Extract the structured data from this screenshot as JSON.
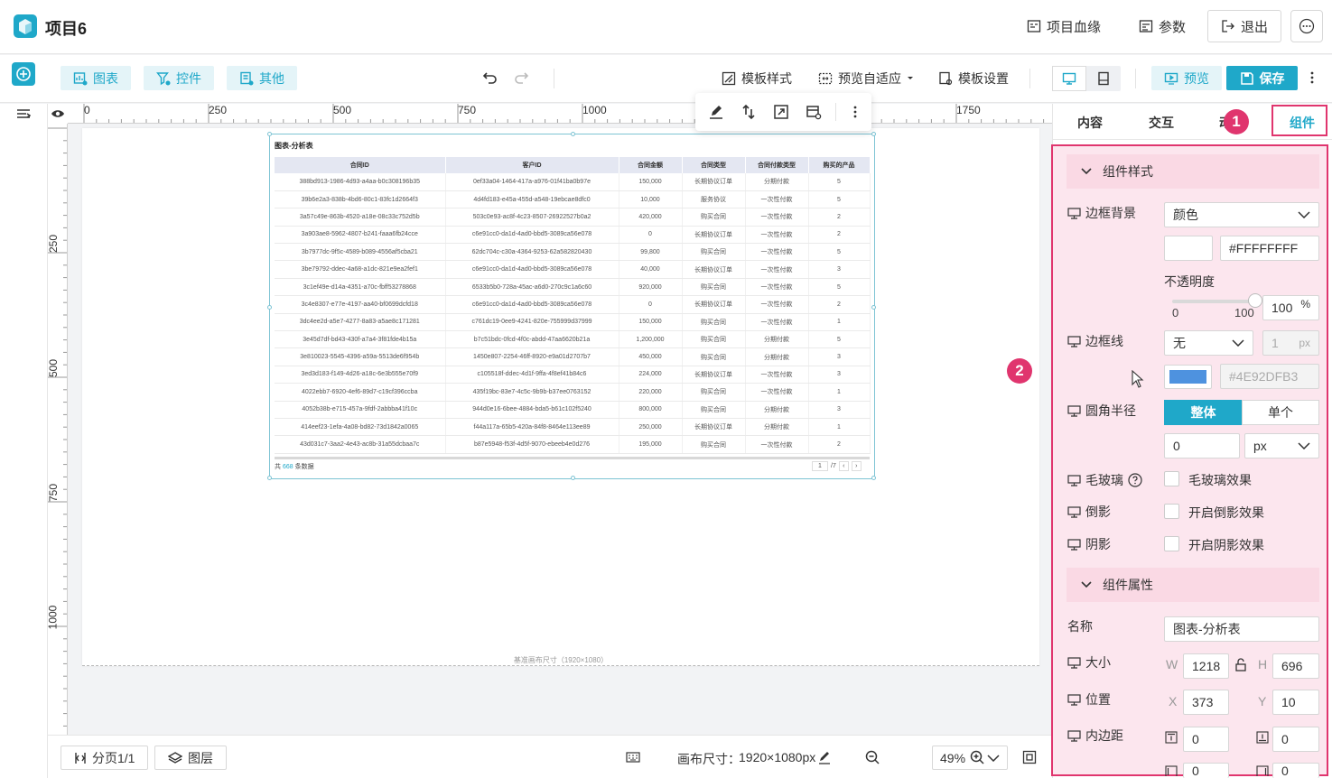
{
  "header": {
    "title": "项目6",
    "lineage": "项目血缘",
    "params": "参数",
    "exit": "退出"
  },
  "toolbar": {
    "chart": "图表",
    "control": "控件",
    "other": "其他",
    "template_style": "模板样式",
    "preview_adaptive": "预览自适应",
    "template_settings": "模板设置",
    "preview": "预览",
    "save": "保存"
  },
  "ruler": {
    "h_labels": [
      "0",
      "250",
      "500",
      "750",
      "1000",
      "1750"
    ],
    "v_labels": [
      "250",
      "500",
      "750",
      "1000"
    ]
  },
  "widget": {
    "title": "图表-分析表",
    "columns": [
      "合同ID",
      "客户ID",
      "合同金额",
      "合同类型",
      "合同付款类型",
      "购买的产品"
    ],
    "rows": [
      [
        "388bd913-1986-4d93-a4aa-b0c308196b35",
        "0ef33a04-1464-417a-a976-01f41ba0b97e",
        "150,000",
        "长期协议订单",
        "分期付款",
        "5"
      ],
      [
        "39b6e2a3-838b-4bd6-80c1-83fc1d2664f3",
        "4d4fd183-e45a-455d-a548-19ebcae8dfc0",
        "10,000",
        "服务协议",
        "一次性付款",
        "5"
      ],
      [
        "3a57c49e-863b-4520-a18e-08c33c752d5b",
        "503c0e93-ac8f-4c23-8507-26922527b0a2",
        "420,000",
        "购买合同",
        "一次性付款",
        "2"
      ],
      [
        "3a903ae8-5962-4807-b241-faaa6fb24cce",
        "c6e91cc0-da1d-4ad0-bbd5-3089ca56e078",
        "0",
        "长期协议订单",
        "一次性付款",
        "2"
      ],
      [
        "3b7977dc-9f5c-4589-b089-4556af5cba21",
        "62dc704c-c30a-4364-9253-62a582820430",
        "99,800",
        "购买合同",
        "一次性付款",
        "5"
      ],
      [
        "3be79792-ddec-4a68-a1dc-821e9ea2fef1",
        "c6e91cc0-da1d-4ad0-bbd5-3089ca56e078",
        "40,000",
        "长期协议订单",
        "一次性付款",
        "3"
      ],
      [
        "3c1ef49e-d14a-4351-a70c-fbff53278868",
        "6533b5b0-728a-45ac-a6d0-270c9c1a6c60",
        "920,000",
        "购买合同",
        "一次性付款",
        "5"
      ],
      [
        "3c4e8307-e77e-4197-aa40-bf0699dcfd18",
        "c6e91cc0-da1d-4ad0-bbd5-3089ca56e078",
        "0",
        "长期协议订单",
        "一次性付款",
        "2"
      ],
      [
        "3dc4ee2d-a5e7-4277-8a83-a5ae8c171281",
        "c761dc19-0ee9-4241-820e-755999d37999",
        "150,000",
        "购买合同",
        "一次性付款",
        "1"
      ],
      [
        "3e45d7df-bd43-430f-a7a4-3f81fde4b15a",
        "b7c51bdc-0fcd-4f0c-abdd-47aa6620b21a",
        "1,200,000",
        "购买合同",
        "分期付款",
        "5"
      ],
      [
        "3e810023-5545-4396-a59a-5513de6f954b",
        "1450e807-2254-46ff-8920-e9a01d2707b7",
        "450,000",
        "购买合同",
        "分期付款",
        "3"
      ],
      [
        "3ed3d183-f149-4d26-a18c-6e3b555e70f9",
        "c105518f-ddec-4d1f-9ffa-4f8ef41b84c6",
        "224,000",
        "长期协议订单",
        "一次性付款",
        "3"
      ],
      [
        "4022ebb7-6920-4ef6-89d7-c19cf396ccba",
        "435f19bc-83e7-4c5c-9b9b-b37ee0763152",
        "220,000",
        "购买合同",
        "一次性付款",
        "1"
      ],
      [
        "4052b38b-e715-457a-9fdf-2abbba41f10c",
        "944d0e16-6bee-4884-bda5-b61c102f5240",
        "800,000",
        "购买合同",
        "分期付款",
        "3"
      ],
      [
        "414eef23-1efa-4a08-bd82-73d1842a0065",
        "f44a117a-65b5-420a-84f8-8464e113ee89",
        "250,000",
        "长期协议订单",
        "分期付款",
        "1"
      ],
      [
        "43d031c7-3aa2-4e43-ac8b-31a55dcbaa7c",
        "b87e5948-f53f-4d5f-9070-ebeeb4e0d276",
        "195,000",
        "购买合同",
        "一次性付款",
        "2"
      ]
    ],
    "footer_prefix": "共",
    "footer_count": "668",
    "footer_suffix": "条数据",
    "page_current": "1",
    "page_total": "/7"
  },
  "canvas_caption": "基准画布尺寸（1920×1080）",
  "bottombar": {
    "pages": "分页1/1",
    "layers": "图层",
    "canvas_size_label": "画布尺寸：",
    "canvas_size": "1920×1080px",
    "zoom": "49%"
  },
  "rpanel": {
    "tabs": [
      "内容",
      "交互",
      "动",
      "组件"
    ],
    "active_tab": "组件",
    "badge1": "1",
    "badge2": "2",
    "section_style": "组件样式",
    "border_bg_label": "边框背景",
    "border_bg_type": "颜色",
    "border_bg_color": "#FFFFFFFF",
    "opacity_label": "不透明度",
    "opacity_min": "0",
    "opacity_max": "100",
    "opacity_value": "100",
    "opacity_unit": "%",
    "border_line_label": "边框线",
    "border_line_value": "无",
    "border_width": "1",
    "border_unit": "px",
    "border_color": "#4E92DFB3",
    "border_color_hex": "#4E92DF",
    "radius_label": "圆角半径",
    "radius_whole": "整体",
    "radius_single": "单个",
    "radius_value": "0",
    "radius_unit": "px",
    "glass_label": "毛玻璃",
    "glass_check": "毛玻璃效果",
    "reflect_label": "倒影",
    "reflect_check": "开启倒影效果",
    "shadow_label": "阴影",
    "shadow_check": "开启阴影效果",
    "section_props": "组件属性",
    "name_label": "名称",
    "name_value": "图表-分析表",
    "size_label": "大小",
    "w_label": "W",
    "w_value": "1218",
    "h_label": "H",
    "h_value": "696",
    "pos_label": "位置",
    "x_label": "X",
    "x_value": "373",
    "y_label": "Y",
    "y_value": "10",
    "padding_label": "内边距",
    "pad_top": "0",
    "pad_bottom": "0",
    "pad_left": "0",
    "pad_right": "0"
  },
  "colors": {
    "accent": "#1fa8c9",
    "highlight": "#e0356e"
  }
}
